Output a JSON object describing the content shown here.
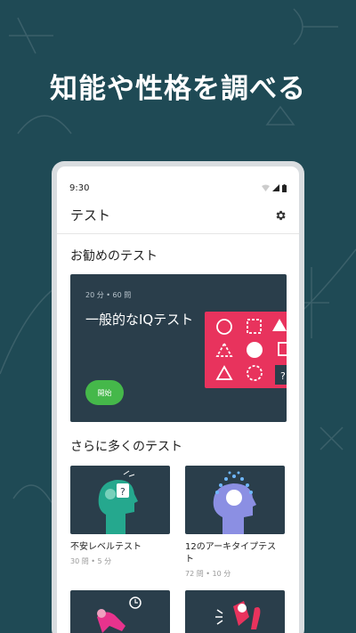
{
  "promo": {
    "headline": "知能や性格を調べる"
  },
  "status_bar": {
    "time": "9:30"
  },
  "app_bar": {
    "title": "テスト",
    "settings_icon": "gear-icon"
  },
  "recommended": {
    "section_title": "お勧めのテスト",
    "featured": {
      "meta": "20 分 • 60 問",
      "title": "一般的なIQテスト",
      "start_label": "開始",
      "accent_color": "#e8335d",
      "start_color": "#45b84a"
    }
  },
  "more": {
    "section_title": "さらに多くのテスト",
    "tests": [
      {
        "title": "不安レベルテスト",
        "meta": "30 問 • 5 分",
        "illustration": "anxious-head-icon"
      },
      {
        "title": "12のアーキタイプテスト",
        "meta": "72 問 • 10 分",
        "illustration": "archetype-head-icon"
      },
      {
        "title": "",
        "meta": "",
        "illustration": "relaxed-person-icon"
      },
      {
        "title": "",
        "meta": "",
        "illustration": "conflict-person-icon"
      }
    ]
  },
  "colors": {
    "background": "#1f4a55",
    "card_dark": "#2a3e4b"
  }
}
